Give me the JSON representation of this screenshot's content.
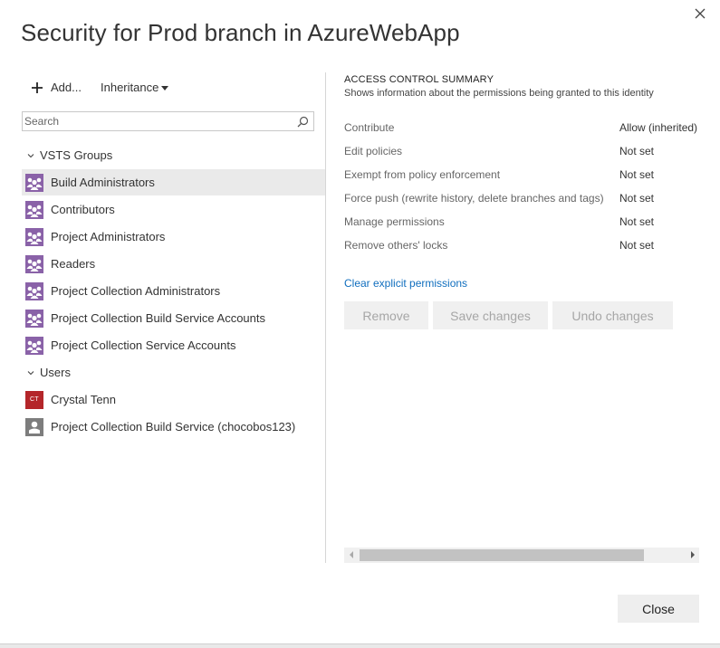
{
  "dialog": {
    "title": "Security for Prod branch in AzureWebApp",
    "close_button_label": "Close"
  },
  "toolbar": {
    "add_label": "Add...",
    "inheritance_label": "Inheritance"
  },
  "search": {
    "placeholder": "Search",
    "value": ""
  },
  "groups": {
    "vsts_header": "VSTS Groups",
    "users_header": "Users",
    "vsts_items": [
      {
        "label": "Build Administrators",
        "selected": true,
        "icon": "group-icon"
      },
      {
        "label": "Contributors",
        "selected": false,
        "icon": "group-icon"
      },
      {
        "label": "Project Administrators",
        "selected": false,
        "icon": "group-icon"
      },
      {
        "label": "Readers",
        "selected": false,
        "icon": "group-icon"
      },
      {
        "label": "Project Collection Administrators",
        "selected": false,
        "icon": "group-icon"
      },
      {
        "label": "Project Collection Build Service Accounts",
        "selected": false,
        "icon": "group-icon"
      },
      {
        "label": "Project Collection Service Accounts",
        "selected": false,
        "icon": "group-icon"
      }
    ],
    "user_items": [
      {
        "label": "Crystal Tenn",
        "avatar_initials": "CT",
        "icon": "user-avatar"
      },
      {
        "label": "Project Collection Build Service (chocobos123)",
        "icon": "service-user-icon"
      }
    ]
  },
  "access_control": {
    "title": "ACCESS CONTROL SUMMARY",
    "subtitle": "Shows information about the permissions being granted to this identity",
    "permissions": [
      {
        "name": "Contribute",
        "value": "Allow (inherited)"
      },
      {
        "name": "Edit policies",
        "value": "Not set"
      },
      {
        "name": "Exempt from policy enforcement",
        "value": "Not set"
      },
      {
        "name": "Force push (rewrite history, delete branches and tags)",
        "value": "Not set"
      },
      {
        "name": "Manage permissions",
        "value": "Not set"
      },
      {
        "name": "Remove others' locks",
        "value": "Not set"
      }
    ],
    "clear_link": "Clear explicit permissions",
    "buttons": {
      "remove": "Remove",
      "save": "Save changes",
      "undo": "Undo changes"
    }
  },
  "colors": {
    "accent_link": "#106ebe",
    "group_icon": "#8a62a8",
    "user_avatar": "#b4262a",
    "selected_row": "#eaeaea"
  }
}
